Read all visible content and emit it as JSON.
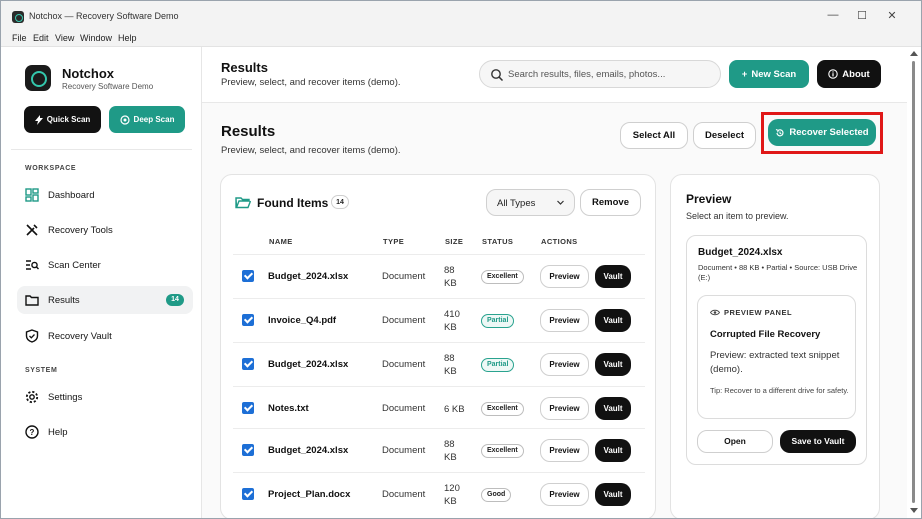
{
  "window": {
    "title": "Notchox — Recovery Software Demo",
    "controls": {
      "minimize": "—",
      "maximize": "☐",
      "close": "✕"
    }
  },
  "menu": [
    "File",
    "Edit",
    "View",
    "Window",
    "Help"
  ],
  "sidebar": {
    "app_name": "Notchox",
    "app_subtitle": "Recovery Software Demo",
    "quick_scan": "Quick Scan",
    "deep_scan": "Deep Scan",
    "workspace_label": "WORKSPACE",
    "system_label": "SYSTEM",
    "workspace_items": [
      {
        "label": "Dashboard",
        "icon": "dashboard-icon"
      },
      {
        "label": "Recovery Tools",
        "icon": "tools-icon"
      },
      {
        "label": "Scan Center",
        "icon": "scan-icon"
      },
      {
        "label": "Results",
        "icon": "folder-icon",
        "badge": "14",
        "active": true
      },
      {
        "label": "Recovery Vault",
        "icon": "shield-icon"
      }
    ],
    "system_items": [
      {
        "label": "Settings",
        "icon": "gear-icon"
      },
      {
        "label": "Help",
        "icon": "help-icon"
      }
    ]
  },
  "header": {
    "title": "Results",
    "subtitle": "Preview, select, and recover items (demo).",
    "search_placeholder": "Search results, files, emails, photos...",
    "new_scan": "New Scan",
    "about": "About"
  },
  "page": {
    "title": "Results",
    "subtitle": "Preview, select, and recover items (demo).",
    "select_all": "Select All",
    "deselect": "Deselect",
    "recover_selected": "Recover Selected"
  },
  "found": {
    "title": "Found Items",
    "count": "14",
    "filter_value": "All Types",
    "remove": "Remove",
    "columns": [
      "NAME",
      "TYPE",
      "SIZE",
      "STATUS",
      "ACTIONS"
    ],
    "preview_label": "Preview",
    "vault_label": "Vault",
    "rows": [
      {
        "name": "Budget_2024.xlsx",
        "type": "Document",
        "size": "88 KB",
        "status": "Excellent",
        "checked": true
      },
      {
        "name": "Invoice_Q4.pdf",
        "type": "Document",
        "size": "410 KB",
        "status": "Partial",
        "checked": true
      },
      {
        "name": "Budget_2024.xlsx",
        "type": "Document",
        "size": "88 KB",
        "status": "Partial",
        "checked": true
      },
      {
        "name": "Notes.txt",
        "type": "Document",
        "size": "6 KB",
        "status": "Excellent",
        "checked": true
      },
      {
        "name": "Budget_2024.xlsx",
        "type": "Document",
        "size": "88 KB",
        "status": "Excellent",
        "checked": true
      },
      {
        "name": "Project_Plan.docx",
        "type": "Document",
        "size": "120 KB",
        "status": "Good",
        "checked": true
      }
    ]
  },
  "preview": {
    "title": "Preview",
    "subtitle": "Select an item to preview.",
    "item_name": "Budget_2024.xlsx",
    "item_meta": "Document • 88 KB • Partial • Source: USB Drive (E:)",
    "panel_label": "PREVIEW PANEL",
    "panel_title": "Corrupted File Recovery",
    "panel_text": "Preview: extracted text snippet (demo).",
    "panel_tip": "Tip: Recover to a different drive for safety.",
    "open": "Open",
    "save_to_vault": "Save to Vault"
  },
  "colors": {
    "accent": "#1f9a87",
    "dark_button": "#111111",
    "checkbox": "#1d6fd6",
    "highlight_box": "#e01818"
  }
}
